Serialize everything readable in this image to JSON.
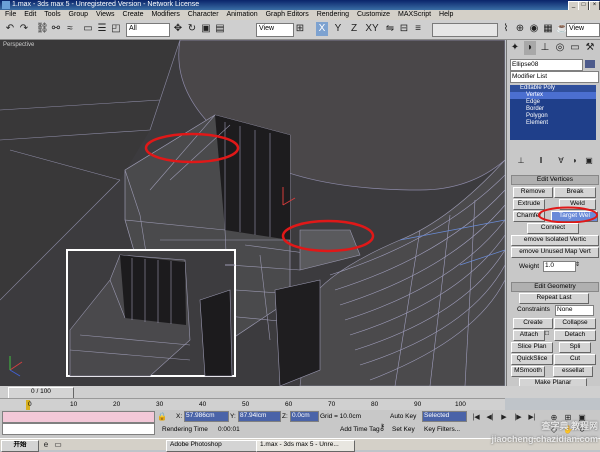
{
  "title": "1.max - 3ds max 5 - Unregistered Version - Network License",
  "menu": [
    "File",
    "Edit",
    "Tools",
    "Group",
    "Views",
    "Create",
    "Modifiers",
    "Character",
    "Animation",
    "Graph Editors",
    "Rendering",
    "Customize",
    "MAXScript",
    "Help"
  ],
  "toolbar": {
    "filter_value": "All",
    "view_value": "View",
    "axis_labels": [
      "X",
      "Y",
      "Z",
      "XY"
    ],
    "right_view": "View"
  },
  "viewport": {
    "label": "Perspective"
  },
  "panel": {
    "object_name": "Ellipse08",
    "modifier_list": "Modifier List",
    "stack": [
      "Editable Poly",
      "Vertex",
      "Edge",
      "Border",
      "Polygon",
      "Element"
    ],
    "edit_vertices": {
      "title": "Edit Vertices",
      "remove": "Remove",
      "break": "Break",
      "extrude": "Extrude",
      "weld": "Weld",
      "chamfer": "Chamfer",
      "target_weld": "Target Wel",
      "connect": "Connect",
      "remove_isolated": "emove Isolated Vertic",
      "remove_unused_map": "emove Unused Map Vert",
      "weight_label": "Weight",
      "weight_value": "1.0"
    },
    "edit_geometry": {
      "title": "Edit Geometry",
      "repeat_last": "Repeat Last",
      "constraints_label": "Constraints",
      "constraints_value": "None",
      "create": "Create",
      "collapse": "Collapse",
      "attach": "Attach",
      "detach": "Detach",
      "slice_plane": "Slice Plan",
      "split": "Spli",
      "quickslice": "QuickSlice",
      "cut": "Cut",
      "msmooth": "MSmooth",
      "tessellate": "essellat",
      "make_planar": "Make Planar"
    }
  },
  "timeline": {
    "slider": "0 / 100"
  },
  "ruler_ticks": [
    "0",
    "10",
    "20",
    "30",
    "40",
    "50",
    "60",
    "70",
    "80",
    "90",
    "100"
  ],
  "status": {
    "x_label": "X:",
    "x_value": "57.986cm",
    "y_label": "Y:",
    "y_value": "87.94lcm",
    "z_label": "Z:",
    "z_value": "0.0cm",
    "grid": "Grid = 10.0cm",
    "auto_key": "Auto Key",
    "selected": "Selected",
    "set_key": "Set Key",
    "key_filters": "Key Filters...",
    "rendering_time_label": "Rendering Time",
    "rendering_time_value": "0:00:01",
    "add_time_tag": "Add Time Tag"
  },
  "taskbar": {
    "start": "开始",
    "items": [
      "Adobe Photoshop",
      "1.max - 3ds max 5 - Unre..."
    ]
  },
  "watermark": "查字典 教程网 jiaocheng.chazidian.com"
}
